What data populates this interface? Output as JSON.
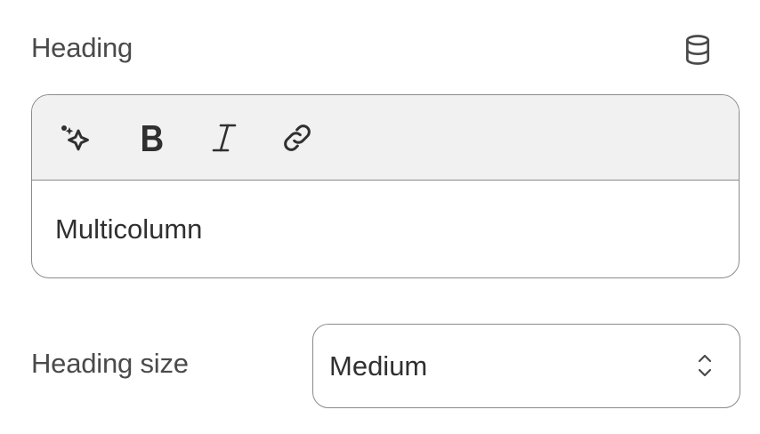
{
  "heading_field": {
    "label": "Heading",
    "dynamic_source_icon": "database-icon",
    "toolbar": {
      "items": [
        {
          "name": "ai-sparkle",
          "icon": "sparkle-icon"
        },
        {
          "name": "bold",
          "icon": "bold-icon",
          "glyph": "B"
        },
        {
          "name": "italic",
          "icon": "italic-icon",
          "glyph": "I"
        },
        {
          "name": "link",
          "icon": "link-icon"
        }
      ]
    },
    "value": "Multicolumn"
  },
  "heading_size_field": {
    "label": "Heading size",
    "selected": "Medium",
    "icon": "chevron-up-down-icon"
  },
  "colors": {
    "border": "#8a8a8a",
    "toolbar_bg": "#f1f1f1",
    "text": "#303030",
    "label": "#4a4a4a"
  }
}
